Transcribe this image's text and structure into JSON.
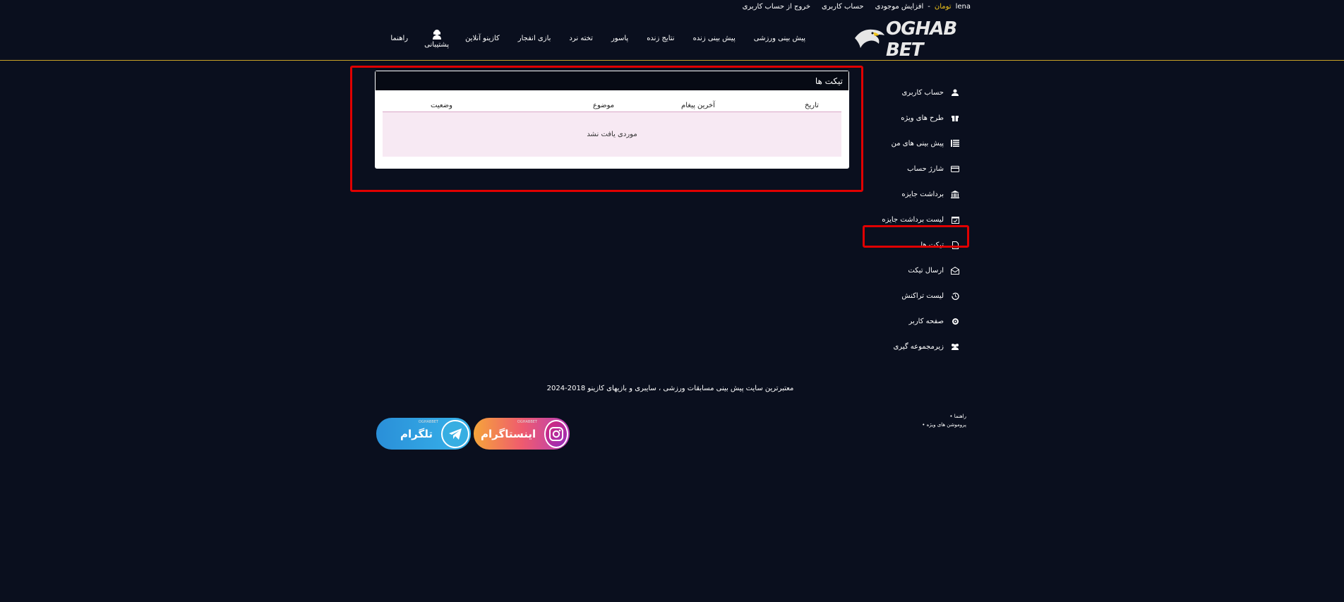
{
  "topbar": {
    "user": "lena",
    "balance": "تومان",
    "separator": "-",
    "links": [
      "افزایش موجودی",
      "حساب کاربری",
      "خروج از حساب کاربری"
    ]
  },
  "header": {
    "logo_text": "OGHAB BET",
    "nav": [
      "پیش بینی ورزشی",
      "پیش بینی زنده",
      "نتایج زنده",
      "پاسور",
      "تخته نرد",
      "بازی انفجار",
      "کازینو آنلاین"
    ],
    "support_label": "پشتیبانی",
    "help_label": "راهنما"
  },
  "sidebar": {
    "items": [
      {
        "label": "حساب کاربری",
        "icon": "user-icon"
      },
      {
        "label": "طرح های ویژه",
        "icon": "gift-icon"
      },
      {
        "label": "پیش بینی های من",
        "icon": "list-icon"
      },
      {
        "label": "شارژ حساب",
        "icon": "credit-card-icon"
      },
      {
        "label": "برداشت جایزه",
        "icon": "bank-icon"
      },
      {
        "label": "لیست برداشت جایزه",
        "icon": "calendar-check-icon"
      },
      {
        "label": "تیکت ها",
        "icon": "file-icon"
      },
      {
        "label": "ارسال تیکت",
        "icon": "envelope-open-icon"
      },
      {
        "label": "لیست تراکنش",
        "icon": "history-icon"
      },
      {
        "label": "صفحه کاربر",
        "icon": "gear-icon"
      },
      {
        "label": "زیرمجموعه گیری",
        "icon": "users-icon"
      }
    ]
  },
  "panel": {
    "title": "تیکت ها",
    "columns": [
      "تاریخ",
      "آخرین پیغام",
      "موضوع",
      "وضعیت"
    ],
    "empty_message": "موردی یافت نشد"
  },
  "footer": {
    "tagline": "معتبرترین سایت پیش بینی مسابقات ورزشی ، سایبری و بازیهای کازینو 2018-2024",
    "links": [
      "• راهنما",
      "• پروموشن های ویژه"
    ],
    "instagram_label": "اینستاگرام",
    "telegram_label": "تلگرام",
    "badge_small": "OGHABBET"
  },
  "colors": {
    "background": "#0a0f1e",
    "accent_gold": "#c9a227",
    "highlight_red": "#e00000",
    "empty_row": "#f7e9f3"
  }
}
